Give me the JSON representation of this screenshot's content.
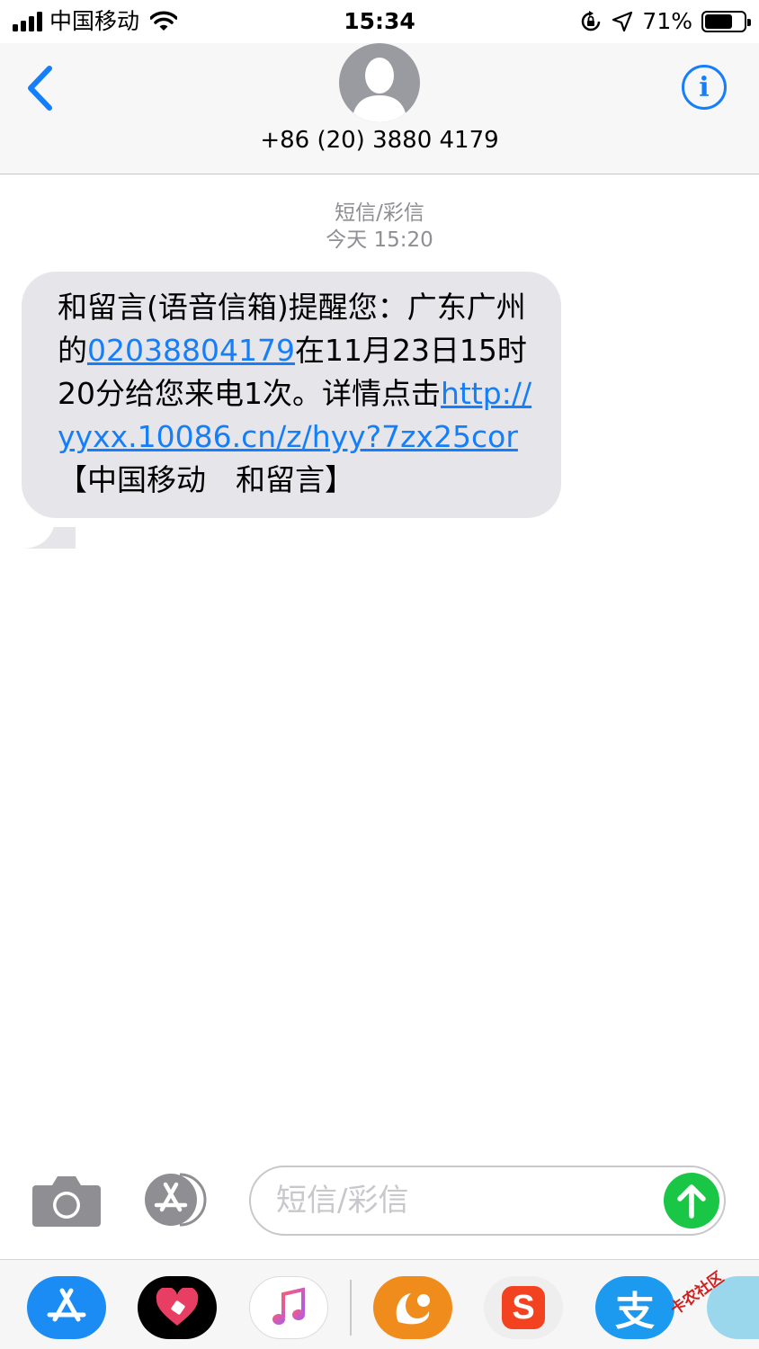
{
  "status_bar": {
    "carrier": "中国移动",
    "time": "15:34",
    "battery_percent": "71%",
    "battery_level": 0.71
  },
  "header": {
    "contact": "+86 (20) 3880 4179",
    "info_glyph": "i"
  },
  "conversation": {
    "service_label": "短信/彩信",
    "timestamp": "今天 15:20",
    "message": {
      "part1": "和留言(语音信箱)提醒您：广东广州的",
      "phone_link": "02038804179",
      "part2": "在11月23日15时20分给您来电1次。详情点击",
      "url_link": "http://yyxx.10086.cn/z/hyy?7zx25cor",
      "part3": "【中国移动　和留言】"
    }
  },
  "input_bar": {
    "placeholder": "短信/彩信"
  },
  "app_drawer": {
    "apps": [
      "app-store-icon",
      "heart-app-icon",
      "music-icon",
      "uc-browser-icon",
      "sogou-input-icon",
      "alipay-icon"
    ],
    "alipay_glyph": "支",
    "sogou_glyph": "S"
  },
  "watermark": "卡农社区",
  "colors": {
    "accent": "#147efb",
    "bubble": "#e5e5ea",
    "send": "#19c646"
  }
}
